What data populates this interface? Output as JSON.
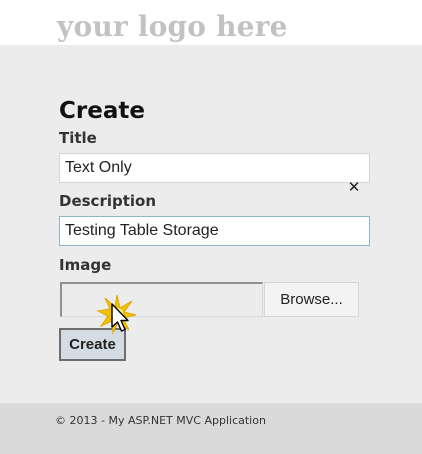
{
  "header": {
    "logo_text": "your logo here"
  },
  "form": {
    "heading": "Create",
    "title": {
      "label": "Title",
      "value": "Text Only"
    },
    "description": {
      "label": "Description",
      "value": "Testing Table Storage",
      "clear_icon": "close-icon"
    },
    "image": {
      "label": "Image",
      "file_value": "",
      "browse_label": "Browse..."
    },
    "submit_label": "Create"
  },
  "footer": {
    "text": "© 2013 - My ASP.NET MVC Application"
  },
  "colors": {
    "logo": "#c2c2c2",
    "page_background": "#ececec",
    "footer_background": "#dadada",
    "focus_border": "#8db6c9",
    "create_button": "#d4dbe2",
    "click_burst": "#f2c200"
  }
}
